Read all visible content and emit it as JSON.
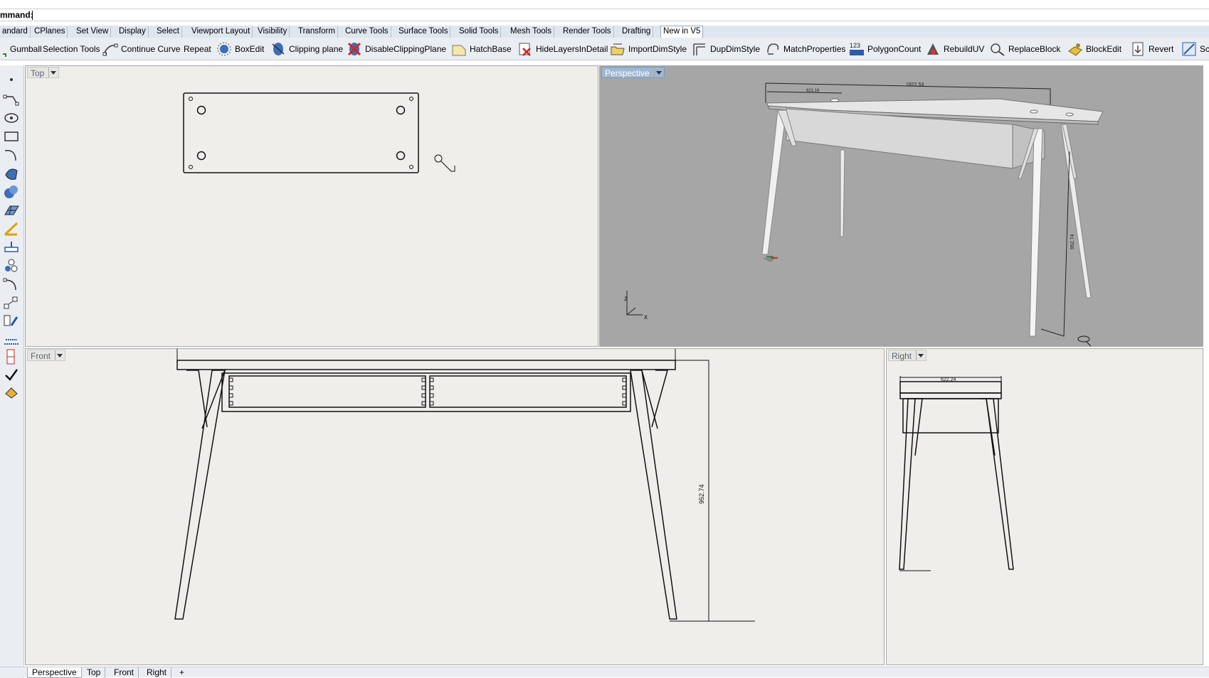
{
  "command": {
    "label": "mmand:",
    "value": ""
  },
  "toolbar_tabs": [
    {
      "label": "andard"
    },
    {
      "label": "CPlanes"
    },
    {
      "label": "Set View"
    },
    {
      "label": "Display"
    },
    {
      "label": "Select"
    },
    {
      "label": "Viewport Layout"
    },
    {
      "label": "Visibility"
    },
    {
      "label": "Transform"
    },
    {
      "label": "Curve Tools"
    },
    {
      "label": "Surface Tools"
    },
    {
      "label": "Solid Tools"
    },
    {
      "label": "Mesh Tools"
    },
    {
      "label": "Render Tools"
    },
    {
      "label": "Drafting"
    },
    {
      "label": "New in V5"
    }
  ],
  "toolbar_buttons": [
    {
      "label": "Gumball",
      "icon": "gumball-icon"
    },
    {
      "label": "Selection Tools",
      "icon": "selection-tools-icon"
    },
    {
      "label": "Continue Curve",
      "icon": "continue-curve-icon"
    },
    {
      "label": "Repeat",
      "icon": "repeat-icon"
    },
    {
      "label": "BoxEdit",
      "icon": "boxedit-icon"
    },
    {
      "label": "Clipping plane",
      "icon": "clipping-plane-icon"
    },
    {
      "label": "DisableClippingPlane",
      "icon": "disable-clipping-plane-icon"
    },
    {
      "label": "HatchBase",
      "icon": "hatchbase-icon"
    },
    {
      "label": "HideLayersInDetail",
      "icon": "hide-layers-icon"
    },
    {
      "label": "ImportDimStyle",
      "icon": "import-dimstyle-icon"
    },
    {
      "label": "DupDimStyle",
      "icon": "dup-dimstyle-icon"
    },
    {
      "label": "MatchProperties",
      "icon": "match-properties-icon"
    },
    {
      "label": "PolygonCount",
      "icon": "polygon-count-icon",
      "glyph": "123"
    },
    {
      "label": "RebuildUV",
      "icon": "rebuild-uv-icon"
    },
    {
      "label": "ReplaceBlock",
      "icon": "replace-block-icon"
    },
    {
      "label": "BlockEdit",
      "icon": "block-edit-icon"
    },
    {
      "label": "Revert",
      "icon": "revert-icon"
    },
    {
      "label": "Sc",
      "icon": "sc-icon"
    }
  ],
  "viewports": {
    "top": {
      "title": "Top"
    },
    "perspective": {
      "title": "Perspective",
      "dim_top": "1822.53",
      "dim_small": "621.16",
      "dim_height": "952.74",
      "axis_z": "z",
      "axis_x": "x"
    },
    "front": {
      "title": "Front",
      "dim_height": "952.74"
    },
    "right": {
      "title": "Right",
      "dim_width": "622.24"
    }
  },
  "bottom_tabs": [
    {
      "label": "Perspective"
    },
    {
      "label": "Top"
    },
    {
      "label": "Front"
    },
    {
      "label": "Right"
    },
    {
      "label": "+"
    }
  ],
  "colors": {
    "toolbar_bg": "#eaeef3",
    "viewport_bg": "#efeeea",
    "perspective_bg": "#a6a6a6",
    "active_title": "#9fb7d2"
  }
}
